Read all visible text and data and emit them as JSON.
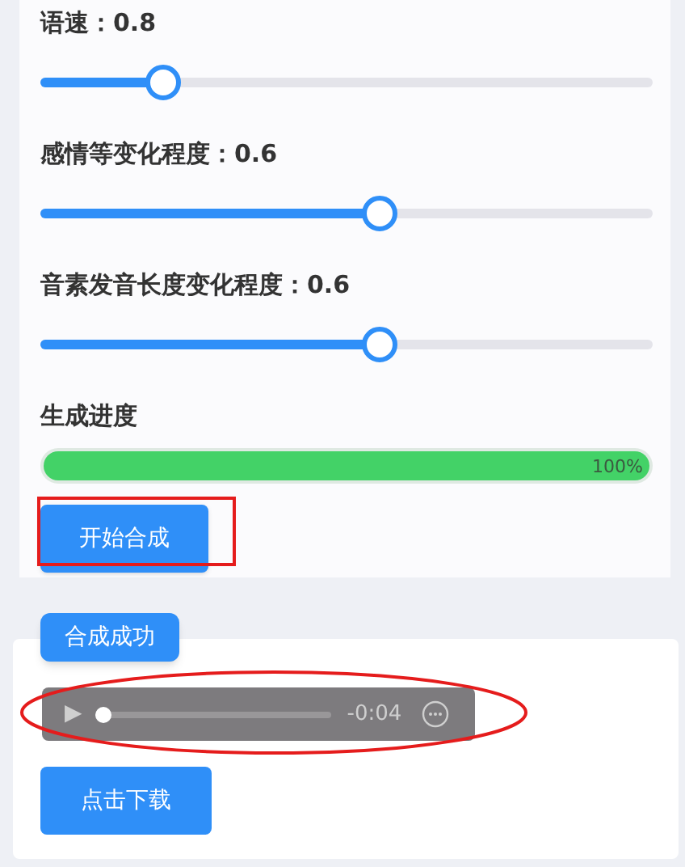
{
  "sliders": [
    {
      "label": "语速：0.8",
      "level": 0.2
    },
    {
      "label": "感情等变化程度：0.6",
      "level": 0.555
    },
    {
      "label": "音素发音长度变化程度：0.6",
      "level": 0.555
    }
  ],
  "progress": {
    "label": "生成进度",
    "level": 1,
    "reading": "100%"
  },
  "start_button": "开始合成",
  "result": {
    "badge": "合成成功",
    "player": {
      "play": "▶",
      "time": "-0:04",
      "level": 0
    },
    "download_button": "点击下载"
  }
}
